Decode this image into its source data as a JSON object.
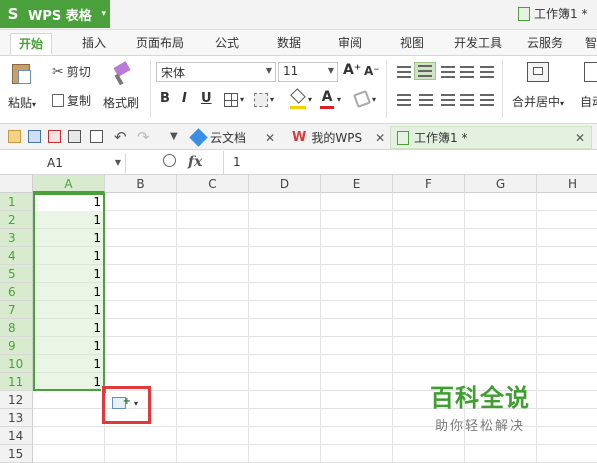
{
  "app": {
    "name": "WPS 表格",
    "logo": "S",
    "menu_arrow": "▾"
  },
  "window": {
    "doc_title": "工作簿1 *"
  },
  "ribbon_tabs": [
    "开始",
    "插入",
    "页面布局",
    "公式",
    "数据",
    "审阅",
    "视图",
    "开发工具",
    "云服务",
    "智"
  ],
  "ribbon": {
    "paste": "粘贴",
    "cut": "剪切",
    "copy": "复制",
    "format_painter": "格式刷",
    "font_name": "宋体",
    "font_size": "11",
    "grow_font": "A⁺",
    "shrink_font": "A⁻",
    "bold": "B",
    "italic": "I",
    "underline": "U",
    "merge_center": "合并居中",
    "auto_wrap": "自动"
  },
  "doc_tabs": [
    {
      "label": "云文档",
      "icon": "cloud-doc-icon"
    },
    {
      "label": "我的WPS",
      "icon": "wps-logo-icon"
    },
    {
      "label": "工作簿1 *",
      "icon": "workbook-icon",
      "active": true
    }
  ],
  "formula_bar": {
    "name_box": "A1",
    "fx": "fx",
    "value": "1"
  },
  "sheet": {
    "columns": [
      "A",
      "B",
      "C",
      "D",
      "E",
      "F",
      "G",
      "H"
    ],
    "rows": [
      "1",
      "2",
      "3",
      "4",
      "5",
      "6",
      "7",
      "8",
      "9",
      "10",
      "11",
      "12",
      "13",
      "14",
      "15"
    ],
    "column_a_values": [
      "1",
      "1",
      "1",
      "1",
      "1",
      "1",
      "1",
      "1",
      "1",
      "1",
      "1"
    ],
    "selection": "A1:A11"
  },
  "watermark": {
    "title": "百科全说",
    "subtitle": "助你轻松解决"
  },
  "colors": {
    "accent": "#4aa13b",
    "highlight_box": "#e0393b"
  }
}
